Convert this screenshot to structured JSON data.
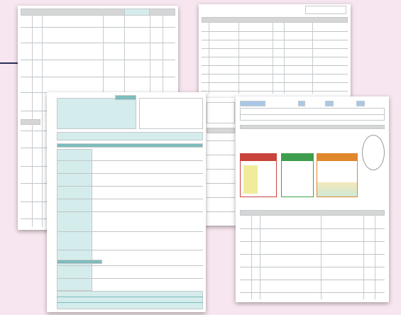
{
  "image": {
    "description_visible_text": "",
    "colors": {
      "background": "#f7e6ef",
      "paper": "#ffffff",
      "teal": "#7fbcbc",
      "red_panel": "#c9443b",
      "green_panel": "#3f9e4d",
      "orange_panel": "#e0872c",
      "pointer_line": "#2c2f57"
    }
  }
}
